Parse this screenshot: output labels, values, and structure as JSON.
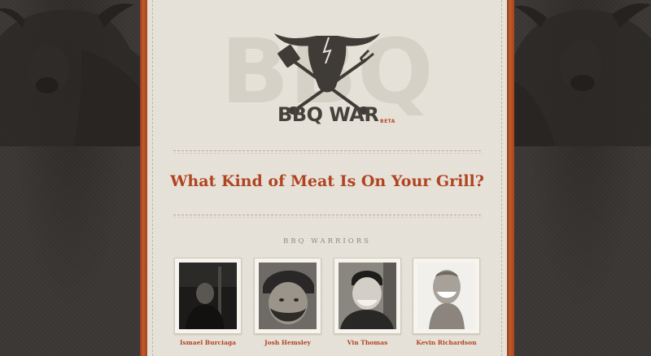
{
  "brand": {
    "name": "BBQ WAR",
    "badge": "BETA",
    "bg_letters": "BBQ",
    "logo_icon": "bull-skull-crossed-spatula-fork-icon"
  },
  "headline": "What Kind of Meat Is On Your Grill?",
  "warriors": {
    "title": "BBQ WARRIORS",
    "people": [
      {
        "name": "Ismael Burciaga"
      },
      {
        "name": "Josh Hemsley"
      },
      {
        "name": "Vin Thomas"
      },
      {
        "name": "Kevin Richardson"
      }
    ]
  },
  "colors": {
    "accent": "#b04421",
    "paper": "#e7e2d8",
    "background": "#3b3734",
    "logo_dark": "#45413b"
  }
}
